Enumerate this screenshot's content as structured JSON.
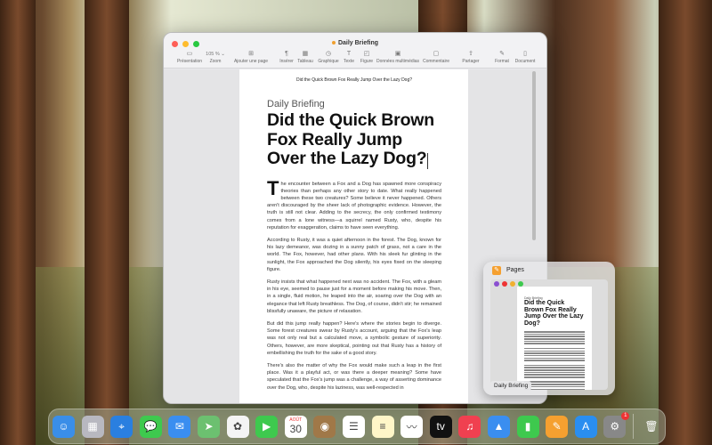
{
  "window": {
    "title": "Daily Briefing"
  },
  "toolbar": [
    {
      "label": "Présentation",
      "icon": "sidebar-icon",
      "glyph": "▭"
    },
    {
      "label": "Zoom",
      "value": "105 % ⌄",
      "icon": "zoom"
    },
    {
      "label": "Ajouter une page",
      "icon": "add-page-icon",
      "glyph": "⊞"
    },
    {
      "label": "Insérer",
      "icon": "insert-icon",
      "glyph": "¶"
    },
    {
      "label": "Tableau",
      "icon": "table-icon",
      "glyph": "▦"
    },
    {
      "label": "Graphique",
      "icon": "chart-icon",
      "glyph": "◷"
    },
    {
      "label": "Texte",
      "icon": "text-icon",
      "glyph": "T"
    },
    {
      "label": "Figure",
      "icon": "shape-icon",
      "glyph": "◰"
    },
    {
      "label": "Données multimédias",
      "icon": "media-icon",
      "glyph": "▣"
    },
    {
      "label": "Commentaire",
      "icon": "comment-icon",
      "glyph": "▢"
    },
    {
      "label": "Partager",
      "icon": "share-icon",
      "glyph": "⇪"
    },
    {
      "label": "Format",
      "icon": "format-icon",
      "glyph": "✎"
    },
    {
      "label": "Document",
      "icon": "document-icon",
      "glyph": "▯"
    }
  ],
  "document": {
    "header": "Did the Quick Brown Fox Really Jump Over the Lazy Dog?",
    "kicker": "Daily Briefing",
    "title": "Did the Quick Brown Fox Really Jump Over the Lazy Dog?",
    "drop_cap": "T",
    "paragraphs": [
      "he encounter between a Fox and a Dog has spawned more conspiracy theories than perhaps any other story to date. What really happened between these two creatures? Some believe it never happened. Others aren't discouraged by the sheer lack of photographic evidence. However, the truth is still not clear. Adding to the secrecy, the only confirmed testimony comes from a lone witness—a squirrel named Rusty, who, despite his reputation for exaggeration, claims to have seen everything.",
      "According to Rusty, it was a quiet afternoon in the forest. The Dog, known for his lazy demeanor, was dozing in a sunny patch of grass, not a care in the world. The Fox, however, had other plans. With his sleek fur glinting in the sunlight, the Fox approached the Dog silently, his eyes fixed on the sleeping figure.",
      "Rusty insists that what happened next was no accident. The Fox, with a gleam in his eye, seemed to pause just for a moment before making his move. Then, in a single, fluid motion, he leaped into the air, soaring over the Dog with an elegance that left Rusty breathless. The Dog, of course, didn't stir; he remained blissfully unaware, the picture of relaxation.",
      "But did this jump really happen? Here's where the stories begin to diverge. Some forest creatures swear by Rusty's account, arguing that the Fox's leap was not only real but a calculated move, a symbolic gesture of superiority. Others, however, are more skeptical, pointing out that Rusty has a history of embellishing the truth for the sake of a good story.",
      "There's also the matter of why the Fox would make such a leap in the first place. Was it a playful act, or was there a deeper meaning? Some have speculated that the Fox's jump was a challenge, a way of asserting dominance over the Dog, who, despite his laziness, was well-respected in"
    ]
  },
  "stage": {
    "app": "Pages",
    "window_label": "Daily Briefing",
    "kicker": "Daily Briefing",
    "title": "Did the Quick Brown Fox Really Jump Over the Lazy Dog?"
  },
  "dock": [
    {
      "name": "finder",
      "color": "#3a8ee8",
      "glyph": "☺"
    },
    {
      "name": "launchpad",
      "color": "#b8b8c0",
      "glyph": "▦"
    },
    {
      "name": "safari",
      "color": "#2a7fe0",
      "glyph": "⌖"
    },
    {
      "name": "messages",
      "color": "#3ec94e",
      "glyph": "💬"
    },
    {
      "name": "mail",
      "color": "#3a8ef0",
      "glyph": "✉"
    },
    {
      "name": "maps",
      "color": "#6cc070",
      "glyph": "➤"
    },
    {
      "name": "photos",
      "color": "#f4f4f4",
      "glyph": "✿"
    },
    {
      "name": "facetime",
      "color": "#3ec94e",
      "glyph": "▶"
    },
    {
      "name": "calendar",
      "color": "#ffffff",
      "glyph": "30",
      "month": "AOÛT"
    },
    {
      "name": "contacts",
      "color": "#a07848",
      "glyph": "◉"
    },
    {
      "name": "reminders",
      "color": "#ffffff",
      "glyph": "☰"
    },
    {
      "name": "notes",
      "color": "#fff6c8",
      "glyph": "≡"
    },
    {
      "name": "freeform",
      "color": "#ffffff",
      "glyph": "〰"
    },
    {
      "name": "apple-tv",
      "color": "#111111",
      "glyph": "tv"
    },
    {
      "name": "music",
      "color": "#f04050",
      "glyph": "♫"
    },
    {
      "name": "keynote",
      "color": "#3a8ef0",
      "glyph": "▲"
    },
    {
      "name": "numbers",
      "color": "#3ec94e",
      "glyph": "▮"
    },
    {
      "name": "pages",
      "color": "#f5a030",
      "glyph": "✎"
    },
    {
      "name": "app-store",
      "color": "#2a8ef0",
      "glyph": "A"
    },
    {
      "name": "system-settings",
      "color": "#888888",
      "glyph": "⚙",
      "badge": "1"
    }
  ],
  "trash": {
    "name": "trash",
    "glyph": "🗑"
  }
}
